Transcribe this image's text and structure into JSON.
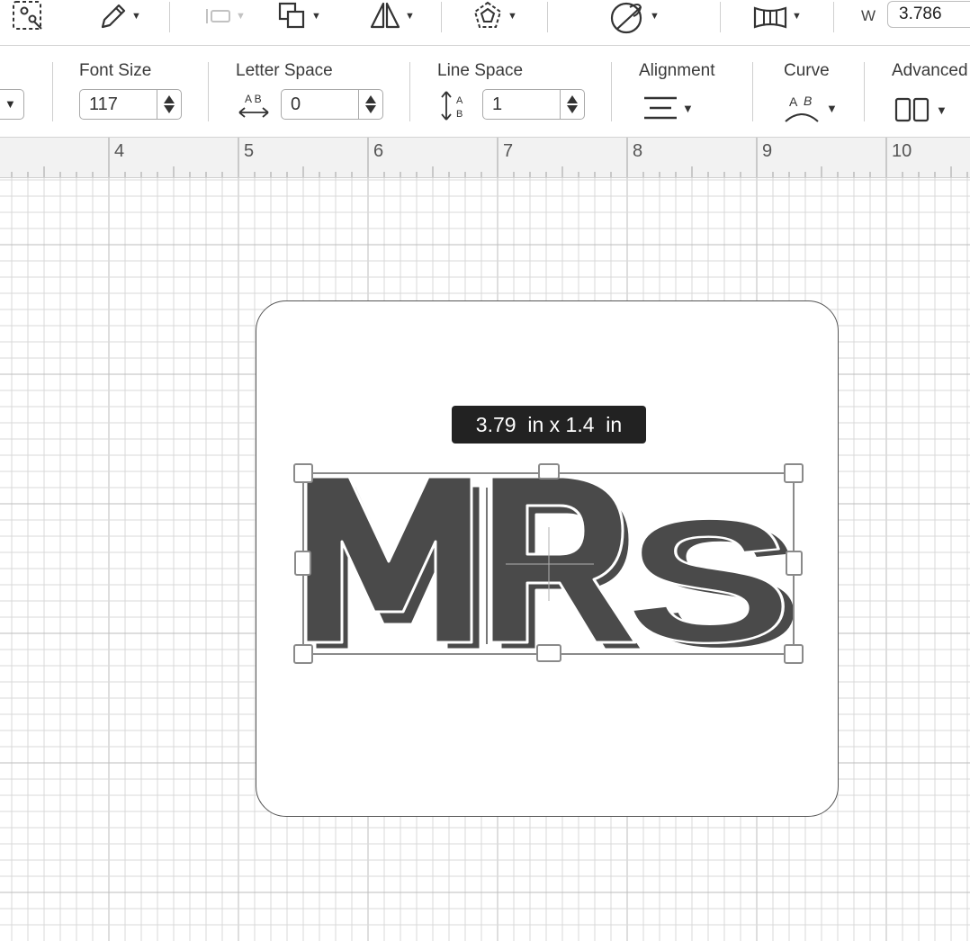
{
  "toolbar": {
    "width_label": "W",
    "width_value": "3.786",
    "icons": [
      "select-all-icon",
      "edit-icon",
      "offset-icon",
      "arrange-icon",
      "flip-icon",
      "shape-icon",
      "warp-icon",
      "slice-icon"
    ]
  },
  "text_toolbar": {
    "font_size": {
      "label": "Font Size",
      "value": "117"
    },
    "letter_space": {
      "label": "Letter Space",
      "value": "0"
    },
    "line_space": {
      "label": "Line Space",
      "value": "1"
    },
    "alignment": {
      "label": "Alignment"
    },
    "curve": {
      "label": "Curve"
    },
    "advanced": {
      "label": "Advanced"
    }
  },
  "ruler": {
    "numbers": [
      "4",
      "5",
      "6",
      "7",
      "8",
      "9",
      "10"
    ]
  },
  "canvas": {
    "dimension_tooltip": "3.79  in x 1.4  in",
    "text_object": "MRS",
    "colors": {
      "text_fill": "#4a4a4a",
      "grid": "#d9d9d9",
      "grid_major": "#bdbdbd",
      "tooltip_bg": "#222222"
    }
  }
}
